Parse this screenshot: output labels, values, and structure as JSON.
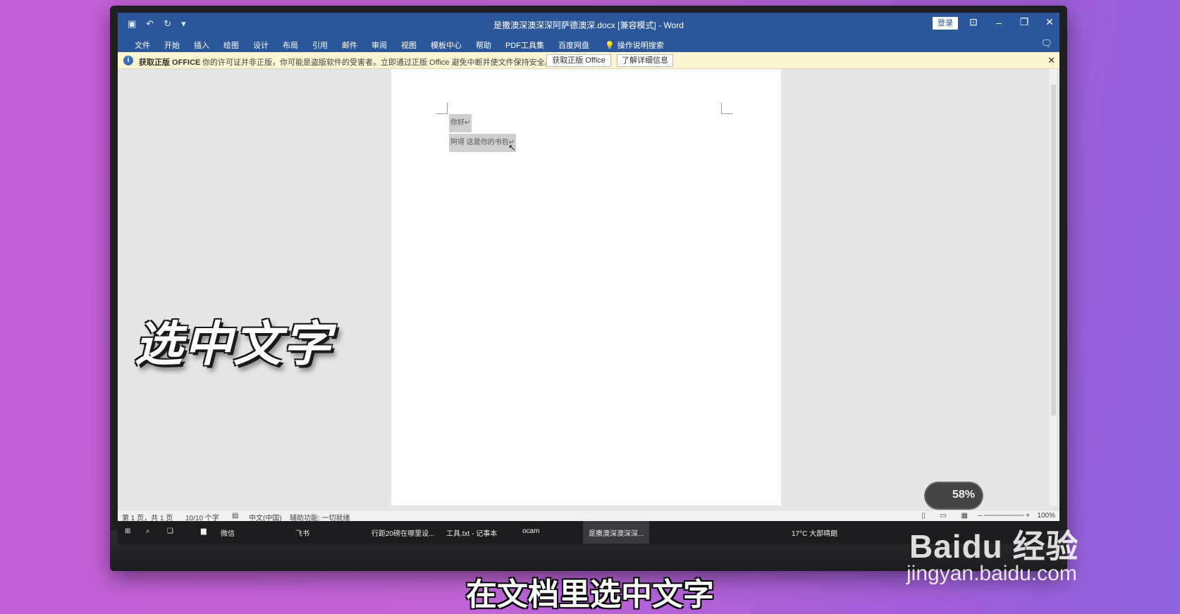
{
  "app": {
    "window_title": "是撒澳深澳深深阿萨德澳深.docx [兼容模式] - Word",
    "login_label": "登录"
  },
  "ribbon": {
    "tabs": [
      "文件",
      "开始",
      "插入",
      "绘图",
      "设计",
      "布局",
      "引用",
      "邮件",
      "审阅",
      "视图",
      "模板中心",
      "帮助",
      "PDF工具集",
      "百度网盘"
    ],
    "search_label": "操作说明搜索"
  },
  "infobar": {
    "title": "获取正版 OFFICE",
    "message": "你的许可证并非正版，你可能是盗版软件的受害者。立即通过正版 Office 避免中断并使文件保持安全。",
    "get_button": "获取正版 Office",
    "learn_button": "了解详细信息"
  },
  "document": {
    "line1": "你好↵",
    "line2": "阿得 这是你的书包↵"
  },
  "status": {
    "page": "第 1 页，共 1 页",
    "word_count": "10/10 个字",
    "language": "中文(中国)",
    "accessibility": "辅助功能: 一切就绪",
    "zoom": "100%"
  },
  "taskbar": {
    "items": [
      "微信",
      "飞书",
      "行距20磅在哪里设...",
      "工具.txt - 记事本",
      "ocam",
      "是撒澳深澳深深..."
    ],
    "weather": "17°C 大部晴朗"
  },
  "widget": {
    "value": "58%"
  },
  "overlay": {
    "caption": "选中文字",
    "subtitle": "在文档里选中文字",
    "watermark_logo": "Baidu 经验",
    "watermark_url": "jingyan.baidu.com"
  },
  "colors": {
    "background": "#c35fd8",
    "word_blue": "#2b579a",
    "infobar": "#fdf6d3",
    "selection": "#cfcfcf"
  }
}
